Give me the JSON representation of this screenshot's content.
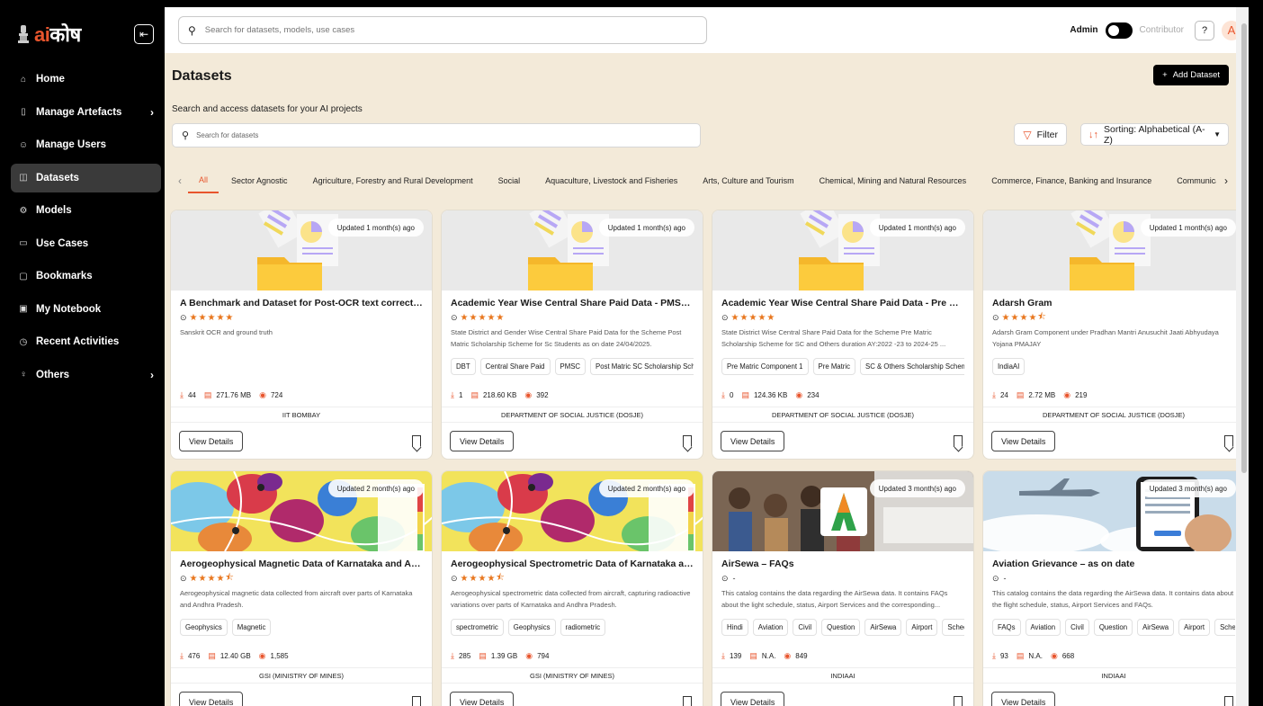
{
  "brand": {
    "ai": "ai",
    "kosh": "कोष"
  },
  "nav": [
    {
      "label": "Home",
      "icon": "home-icon",
      "glyph": "⌂",
      "chev": ""
    },
    {
      "label": "Manage Artefacts",
      "icon": "artefact-icon",
      "glyph": "▯",
      "chev": "›"
    },
    {
      "label": "Manage Users",
      "icon": "users-icon",
      "glyph": "☺",
      "chev": ""
    },
    {
      "label": "Datasets",
      "icon": "database-icon",
      "glyph": "◫",
      "chev": "",
      "active": true
    },
    {
      "label": "Models",
      "icon": "model-icon",
      "glyph": "⚙",
      "chev": ""
    },
    {
      "label": "Use Cases",
      "icon": "usecase-icon",
      "glyph": "▭",
      "chev": ""
    },
    {
      "label": "Bookmarks",
      "icon": "bookmark-icon",
      "glyph": "▢",
      "chev": ""
    },
    {
      "label": "My Notebook",
      "icon": "notebook-icon",
      "glyph": "▣",
      "chev": ""
    },
    {
      "label": "Recent Activities",
      "icon": "clock-icon",
      "glyph": "◷",
      "chev": ""
    },
    {
      "label": "Others",
      "icon": "others-icon",
      "glyph": "♀",
      "chev": "›"
    }
  ],
  "topbar": {
    "search_placeholder": "Search for datasets, models, use cases",
    "role_admin": "Admin",
    "role_contributor": "Contributor",
    "help": "?",
    "avatar": "A"
  },
  "header": {
    "title": "Datasets",
    "add_label": "Add Dataset",
    "subtitle": "Search and access datasets for your AI projects",
    "search_placeholder": "Search for datasets",
    "filter_label": "Filter",
    "sort_label": "Sorting: Alphabetical (A-Z)"
  },
  "tabs": [
    "All",
    "Sector Agnostic",
    "Agriculture, Forestry and Rural Development",
    "Social",
    "Aquaculture, Livestock and Fisheries",
    "Arts, Culture and Tourism",
    "Chemical, Mining and Natural Resources",
    "Commerce, Finance, Banking and Insurance",
    "Communica"
  ],
  "cards": [
    {
      "updated": "Updated 1 month(s) ago",
      "title": "A Benchmark and Dataset for Post-OCR text correction i...",
      "stars": 5,
      "desc": "Sanskrit OCR and ground truth",
      "tags": [],
      "downloads": "44",
      "size": "271.76 MB",
      "views": "724",
      "org": "IIT BOMBAY",
      "img": "folder"
    },
    {
      "updated": "Updated 1 month(s) ago",
      "title": "Academic Year Wise Central Share Paid Data - PMSC till...",
      "stars": 5,
      "desc": "State District and Gender Wise Central Share Paid Data for the Scheme Post Matric Scholarship Scheme for Sc Students as on date 24/04/2025.",
      "tags": [
        "DBT",
        "Central Share Paid",
        "PMSC",
        "Post Matric SC Scholarship Schem"
      ],
      "downloads": "1",
      "size": "218.60 KB",
      "views": "392",
      "org": "DEPARTMENT OF SOCIAL JUSTICE (DOSJE)",
      "img": "folder"
    },
    {
      "updated": "Updated 1 month(s) ago",
      "title": "Academic Year Wise Central Share Paid Data - Pre Matri...",
      "stars": 5,
      "desc": "State District Wise Central Share Paid Data for the Scheme Pre Matric Scholarship Scheme for SC and Others duration AY:2022 -23 to 2024-25 ...",
      "tags": [
        "Pre Matric Component 1",
        "Pre Matric",
        "SC & Others Scholarship Scheme"
      ],
      "downloads": "0",
      "size": "124.36 KB",
      "views": "234",
      "org": "DEPARTMENT OF SOCIAL JUSTICE (DOSJE)",
      "img": "folder"
    },
    {
      "updated": "Updated 1 month(s) ago",
      "title": "Adarsh Gram",
      "stars": 4.5,
      "desc": "Adarsh Gram Component under Pradhan Mantri Anusuchit Jaati Abhyudaya Yojana PMAJAY",
      "tags": [
        "IndiaAI"
      ],
      "downloads": "24",
      "size": "2.72 MB",
      "views": "219",
      "org": "DEPARTMENT OF SOCIAL JUSTICE (DOSJE)",
      "img": "folder"
    },
    {
      "updated": "Updated 2 month(s) ago",
      "title": "Aerogeophysical Magnetic Data of Karnataka and Andhr...",
      "stars": 4.5,
      "desc": "Aerogeophysical magnetic data collected from aircraft over parts of Karnataka and Andhra Pradesh.",
      "tags": [
        "Geophysics",
        "Magnetic"
      ],
      "downloads": "476",
      "size": "12.40 GB",
      "views": "1,585",
      "org": "GSI (MINISTRY OF MINES)",
      "img": "map"
    },
    {
      "updated": "Updated 2 month(s) ago",
      "title": "Aerogeophysical Spectrometric Data of Karnataka and ...",
      "stars": 4.5,
      "desc": "Aerogeophysical spectrometric data collected from aircraft, capturing radioactive variations over parts of Karnataka and Andhra Pradesh.",
      "tags": [
        "spectrometric",
        "Geophysics",
        "radiometric"
      ],
      "downloads": "285",
      "size": "1.39 GB",
      "views": "794",
      "org": "GSI (MINISTRY OF MINES)",
      "img": "map"
    },
    {
      "updated": "Updated 3 month(s) ago",
      "title": "AirSewa – FAQs",
      "stars": 0,
      "desc": "This catalog contains the data regarding the AirSewa data. It contains FAQs about the light schedule, status, Airport Services and the corresponding...",
      "tags": [
        "Hindi",
        "Aviation",
        "Civil",
        "Question",
        "AirSewa",
        "Airport",
        "Schedule"
      ],
      "downloads": "139",
      "size": "N.A.",
      "views": "849",
      "org": "INDIAAI",
      "img": "crowd"
    },
    {
      "updated": "Updated 3 month(s) ago",
      "title": "Aviation Grievance – as on date",
      "stars": 0,
      "desc": "This catalog contains the data regarding the AirSewa data. It contains data about the flight schedule, status, Airport Services and FAQs.",
      "tags": [
        "FAQs",
        "Aviation",
        "Civil",
        "Question",
        "AirSewa",
        "Airport",
        "Schedule"
      ],
      "downloads": "93",
      "size": "N.A.",
      "views": "668",
      "org": "INDIAAI",
      "img": "plane"
    }
  ],
  "view_details": "View Details",
  "no_rating": "-",
  "colors": {
    "accent": "#e8552d",
    "header_bg": "#f3ead9",
    "sidebar_bg": "#000000"
  }
}
